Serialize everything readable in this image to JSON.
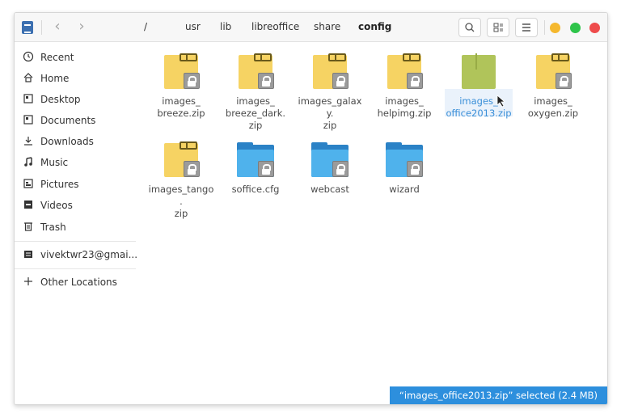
{
  "header": {
    "back_icon": "chevron-left-icon",
    "forward_icon": "chevron-right-icon",
    "breadcrumbs": [
      "/",
      "usr",
      "lib",
      "libreoffice",
      "share",
      "config"
    ],
    "current_crumb": "config",
    "search_icon": "search-icon",
    "view_icon": "view-options-icon",
    "menu_icon": "hamburger-icon",
    "window_controls": {
      "minimize_color": "#f5b82e",
      "maximize_color": "#2ec44a",
      "close_color": "#ee4b4b"
    }
  },
  "sidebar": {
    "places": [
      {
        "label": "Recent",
        "icon": "clock-icon"
      },
      {
        "label": "Home",
        "icon": "home-icon"
      },
      {
        "label": "Desktop",
        "icon": "desktop-icon"
      },
      {
        "label": "Documents",
        "icon": "documents-icon"
      },
      {
        "label": "Downloads",
        "icon": "download-icon"
      },
      {
        "label": "Music",
        "icon": "music-icon"
      },
      {
        "label": "Pictures",
        "icon": "pictures-icon"
      },
      {
        "label": "Videos",
        "icon": "videos-icon"
      },
      {
        "label": "Trash",
        "icon": "trash-icon"
      }
    ],
    "drive": {
      "label": "vivektwr23@gmai...",
      "icon": "drive-icon"
    },
    "other": {
      "label": "Other Locations",
      "icon": "plus-icon"
    }
  },
  "files": [
    {
      "name": "images_\nbreeze.zip",
      "type": "zip"
    },
    {
      "name": "images_\nbreeze_dark.\nzip",
      "type": "zip"
    },
    {
      "name": "images_galaxy.\nzip",
      "type": "zip"
    },
    {
      "name": "images_\nhelpimg.zip",
      "type": "zip"
    },
    {
      "name": "images_\noffice2013.zip",
      "type": "zip",
      "selected": true
    },
    {
      "name": "images_\noxygen.zip",
      "type": "zip"
    },
    {
      "name": "images_tango.\nzip",
      "type": "zip"
    },
    {
      "name": "soffice.cfg",
      "type": "folder"
    },
    {
      "name": "webcast",
      "type": "folder"
    },
    {
      "name": "wizard",
      "type": "folder"
    }
  ],
  "status": {
    "text": "“images_office2013.zip” selected  (2.4 MB)"
  },
  "colors": {
    "accent": "#2d8fdd",
    "folder": "#4fb2ec",
    "zip": "#f6d363",
    "zip_selected": "#b0c45a"
  }
}
